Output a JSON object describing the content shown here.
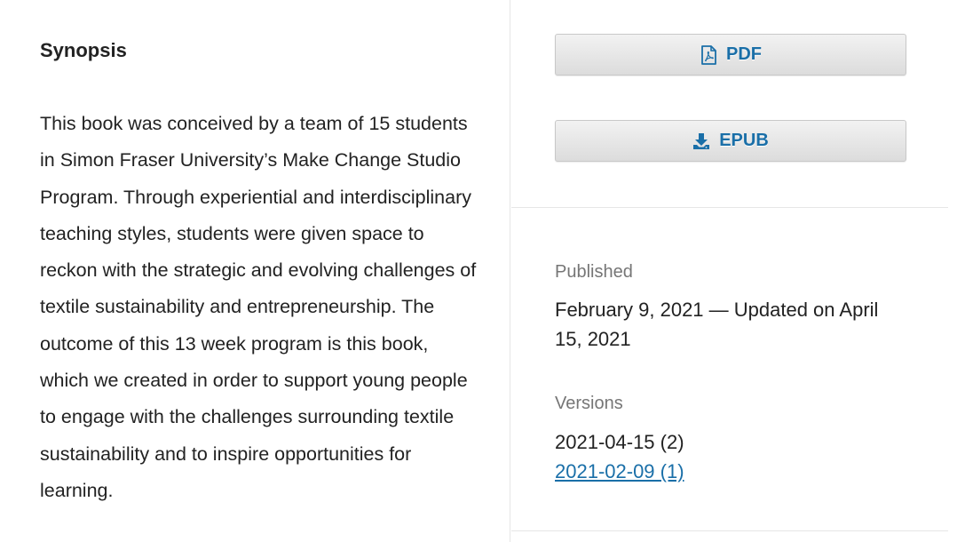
{
  "synopsis": {
    "heading": "Synopsis",
    "text": "This book was conceived by a team of 15 students in Simon Fraser University’s Make Change Studio Program. Through experiential and interdisciplinary teaching styles, students were given space to reckon with the strategic and evolving challenges of textile sustainability and entrepreneurship. The outcome of this 13 week program is this book, which we created in order to support young people to engage with the challenges surrounding textile sustainability and to inspire opportunities for learning."
  },
  "downloads": {
    "pdf_label": "PDF",
    "pdf_icon": "file-pdf-icon",
    "epub_label": "EPUB",
    "epub_icon": "download-icon"
  },
  "published": {
    "label": "Published",
    "value": "February 9, 2021 — Updated on April 15, 2021"
  },
  "versions": {
    "label": "Versions",
    "current": "2021-04-15 (2)",
    "previous": "2021-02-09 (1)"
  },
  "colors": {
    "link": "#1a6fa8",
    "label_gray": "#767676",
    "text": "#222222",
    "divider": "#e6e6e6"
  }
}
